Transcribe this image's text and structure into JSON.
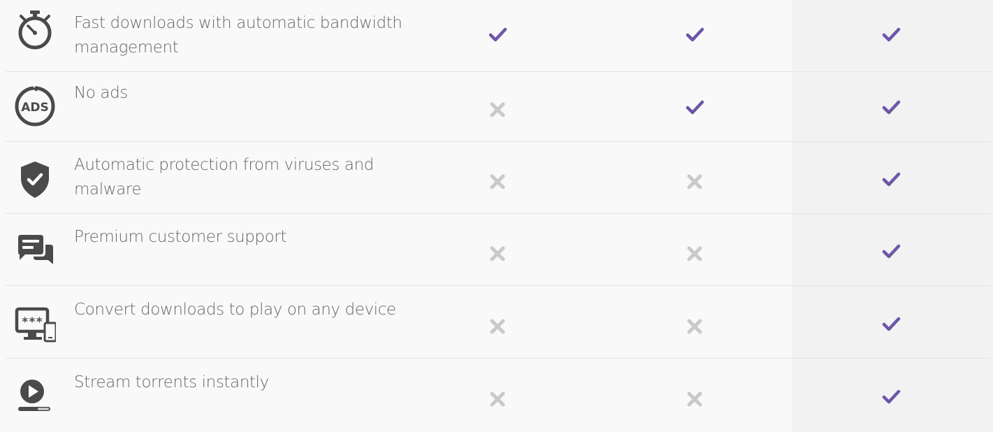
{
  "colors": {
    "check": "#6e55a8",
    "cross": "#c9c9c9",
    "icon": "#4a4a4a",
    "label": "#666666"
  },
  "features": [
    {
      "label": "Fast downloads with automatic bandwidth management",
      "icon": "stopwatch-icon",
      "plans": [
        true,
        true,
        true
      ]
    },
    {
      "label": "No ads",
      "icon": "no-ads-icon",
      "plans": [
        false,
        true,
        true
      ]
    },
    {
      "label": "Automatic protection from viruses and malware",
      "icon": "shield-check-icon",
      "plans": [
        false,
        false,
        true
      ]
    },
    {
      "label": "Premium customer support",
      "icon": "chat-bubbles-icon",
      "plans": [
        false,
        false,
        true
      ]
    },
    {
      "label": "Convert downloads to play on any device",
      "icon": "monitor-phone-icon",
      "plans": [
        false,
        false,
        true
      ]
    },
    {
      "label": "Stream torrents instantly",
      "icon": "play-stream-icon",
      "plans": [
        false,
        false,
        true
      ]
    }
  ],
  "icon_text": {
    "ads": "ADS",
    "password": "***"
  }
}
